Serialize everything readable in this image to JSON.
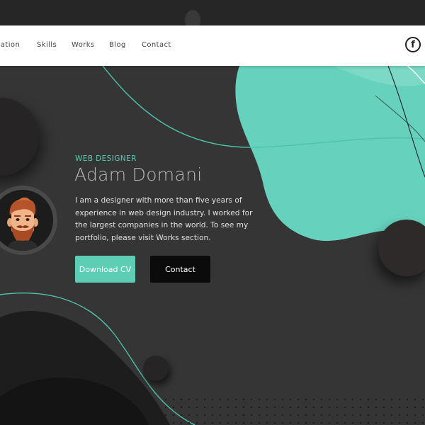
{
  "nav": {
    "items": [
      "cation",
      "Skills",
      "Works",
      "Blog",
      "Contact"
    ],
    "facebook_glyph": "f"
  },
  "hero": {
    "role": "WEB DESIGNER",
    "name": "Adam Domani",
    "bio": "I am a designer with more than five years of experience in web design industry. I worked for the largest companies in the world. To see my portfolio, please visit Works section.",
    "download_button": "Download CV",
    "contact_button": "Contact"
  },
  "colors": {
    "accent": "#5dcdb4",
    "background": "#363535",
    "navbar": "#ffffff",
    "dark_circle": "#262424"
  },
  "icons": {
    "facebook": "facebook-icon",
    "avatar": "bearded-man-avatar"
  }
}
